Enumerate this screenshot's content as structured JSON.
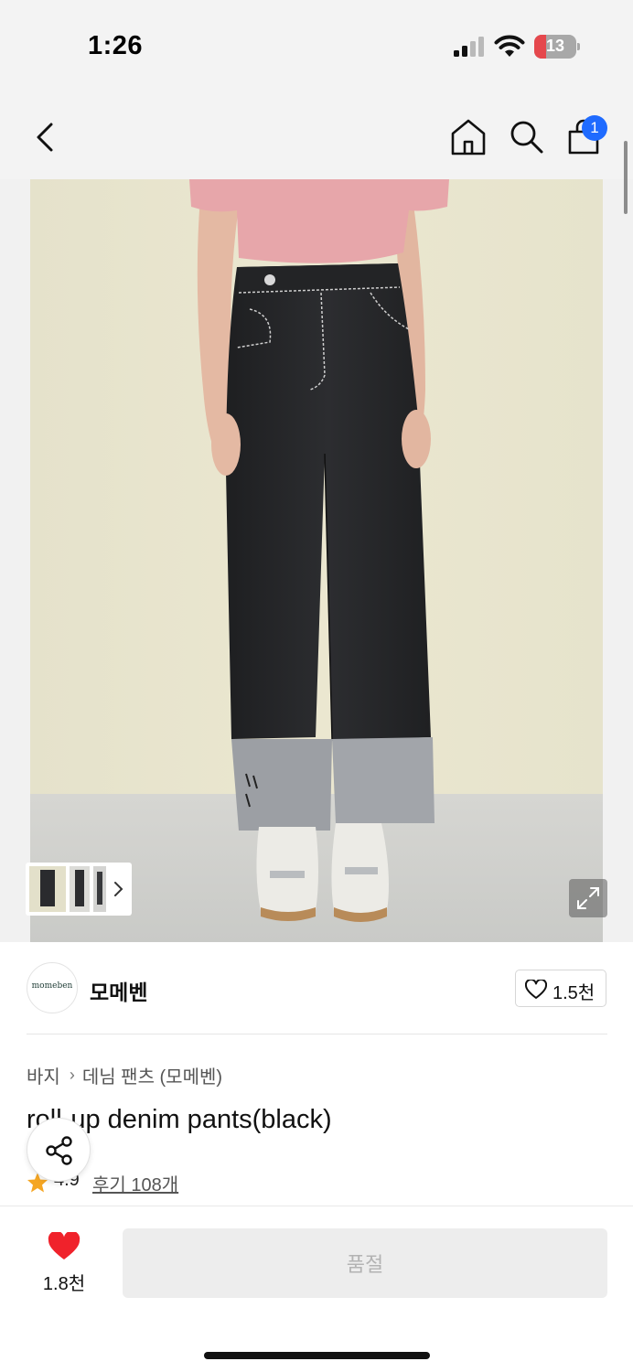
{
  "status_bar": {
    "time": "1:26",
    "battery": "13"
  },
  "nav": {
    "back_icon": "chevron-left-icon",
    "home_icon": "home-icon",
    "search_icon": "search-icon",
    "cart_icon": "shopping-bag-icon",
    "cart_badge": "1",
    "badge_color": "#1f6bff"
  },
  "gallery": {
    "main_image": "model wearing roll-up black denim pants with pink sweatshirt and white sneakers",
    "thumbnail_count": 3,
    "expand_icon": "expand-icon"
  },
  "brand": {
    "logo_text": "momeben",
    "name": "모메벤",
    "like_icon": "heart-outline-icon",
    "like_count": "1.5천"
  },
  "product": {
    "category": "바지",
    "subcategory": "데님 팬츠 (모메벤)",
    "title": "roll-up denim pants(black)",
    "rating": "4.9",
    "review_link": "후기 108개",
    "star_color": "#f5a623"
  },
  "share": {
    "icon": "share-icon"
  },
  "bottom_bar": {
    "wish_icon": "heart-filled-icon",
    "wish_color": "#f0222b",
    "wish_count": "1.8천",
    "soldout_label": "품절"
  }
}
